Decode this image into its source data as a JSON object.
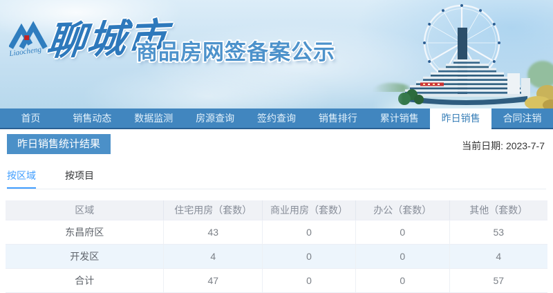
{
  "banner": {
    "logo_script": "Liaocheng",
    "city": "聊城市",
    "title": "商品房网签备案公示"
  },
  "nav": {
    "items": [
      {
        "label": "首页",
        "active": false
      },
      {
        "label": "销售动态",
        "active": false
      },
      {
        "label": "数据监测",
        "active": false
      },
      {
        "label": "房源查询",
        "active": false
      },
      {
        "label": "签约查询",
        "active": false
      },
      {
        "label": "销售排行",
        "active": false
      },
      {
        "label": "累计销售",
        "active": false
      },
      {
        "label": "昨日销售",
        "active": true
      },
      {
        "label": "合同注销",
        "active": false
      }
    ]
  },
  "page": {
    "section_title": "昨日销售统计结果",
    "current_date": "当前日期: 2023-7-7"
  },
  "tabs": [
    {
      "label": "按区域",
      "active": true
    },
    {
      "label": "按项目",
      "active": false
    }
  ],
  "table": {
    "headers": [
      "区域",
      "住宅用房（套数）",
      "商业用房（套数）",
      "办公（套数）",
      "其他（套数）"
    ],
    "rows": [
      {
        "region": "东昌府区",
        "values": [
          43,
          0,
          0,
          53
        ]
      },
      {
        "region": "开发区",
        "values": [
          4,
          0,
          0,
          4
        ]
      },
      {
        "region": "合计",
        "values": [
          47,
          0,
          0,
          57
        ]
      }
    ]
  },
  "colors": {
    "nav_blue": "#4186bf",
    "nav_border": "#2a6093",
    "badge_blue": "#4b90c8",
    "tab_active_blue": "#409eff",
    "zebra_row": "#edf5fc",
    "banner_title_blue": "#4d92cb"
  }
}
